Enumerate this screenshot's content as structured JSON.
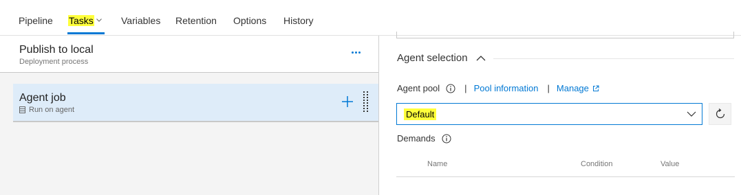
{
  "tabs": [
    {
      "label": "Pipeline"
    },
    {
      "label": "Tasks"
    },
    {
      "label": "Variables"
    },
    {
      "label": "Retention"
    },
    {
      "label": "Options"
    },
    {
      "label": "History"
    }
  ],
  "process": {
    "title": "Publish to local",
    "subtitle": "Deployment process"
  },
  "job": {
    "title": "Agent job",
    "subtitle": "Run on agent"
  },
  "agent_selection": {
    "title": "Agent selection",
    "agent_pool_label": "Agent pool",
    "pool_information_link": "Pool information",
    "manage_link": "Manage",
    "pool_value": "Default",
    "demands_label": "Demands",
    "columns": [
      "Name",
      "Condition",
      "Value"
    ]
  },
  "colors": {
    "accent": "#0078d4",
    "highlight": "#ffff3b",
    "selected_job_bg": "#deecf9"
  }
}
